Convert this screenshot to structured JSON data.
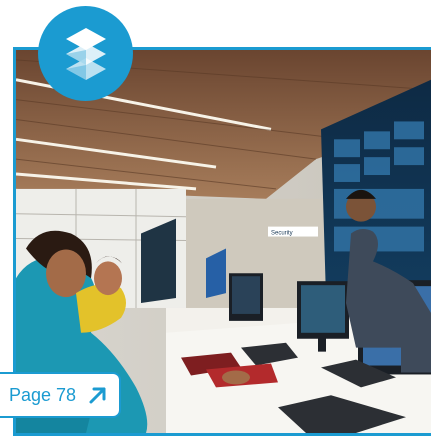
{
  "colors": {
    "accent": "#1b9bd1",
    "background": "#ffffff"
  },
  "badge": {
    "icon": "layers-diamond-icon"
  },
  "page_link": {
    "label": "Page 78",
    "icon": "arrow-up-right-icon"
  },
  "photo": {
    "screen_texts": [
      "Security"
    ]
  }
}
